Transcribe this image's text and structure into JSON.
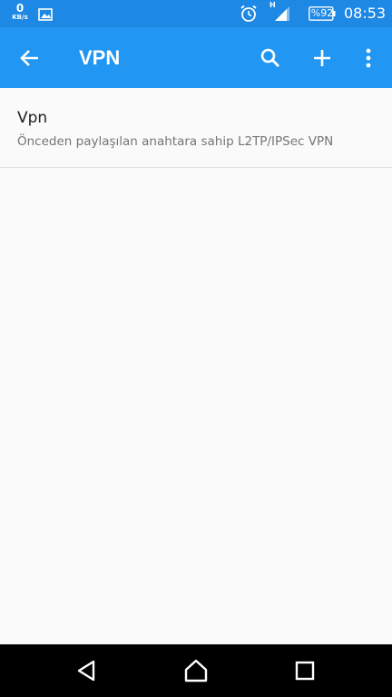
{
  "status_bar": {
    "net_speed_value": "0",
    "net_speed_unit": "KB/s",
    "icons": [
      "image-icon",
      "alarm-icon",
      "signal-icon"
    ],
    "network_type": "H",
    "battery": "%92",
    "time": "08:53"
  },
  "app_bar": {
    "title": "VPN",
    "icons": [
      "back-arrow-icon",
      "search-icon",
      "add-icon",
      "more-vert-icon"
    ]
  },
  "vpn_list": [
    {
      "name": "Vpn",
      "type": "Önceden paylaşılan anahtara sahip L2TP/IPSec VPN"
    }
  ],
  "nav_bar": {
    "icons": [
      "back-triangle-icon",
      "home-icon",
      "recents-square-icon"
    ]
  },
  "colors": {
    "status_bar": "#1e88e5",
    "app_bar": "#2196f3",
    "background": "#fafafa",
    "nav_bar": "#000000"
  }
}
